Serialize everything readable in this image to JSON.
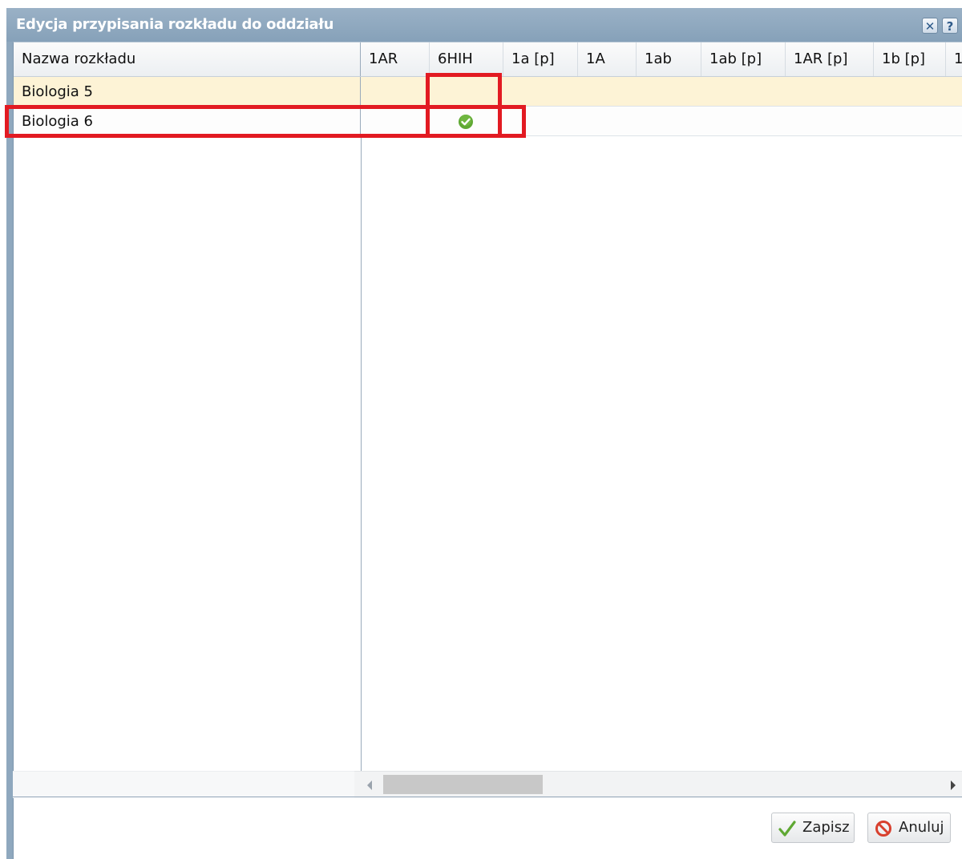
{
  "dialog": {
    "title": "Edycja przypisania rozkładu do oddziału",
    "close_glyph": "✕",
    "help_glyph": "?"
  },
  "grid": {
    "columns": [
      "Nazwa rozkładu",
      "1AR",
      "6HIH",
      "1a [p]",
      "1A",
      "1ab",
      "1ab [p]",
      "1AR [p]",
      "1b [p]",
      "1"
    ],
    "rows": [
      {
        "name": "Biologia 5",
        "assigned": []
      },
      {
        "name": "Biologia 6",
        "assigned": [
          "6HIH"
        ]
      }
    ]
  },
  "icons": {
    "assigned_cell": "check-circle-icon",
    "save": "checkmark-icon",
    "cancel": "prohibited-icon",
    "scroll_left": "arrow-left-icon",
    "scroll_right": "arrow-right-icon"
  },
  "colors": {
    "titlebar": "#8fa8be",
    "selected_row": "#fdf3d6",
    "highlight": "#e21a22",
    "check": "#5fa833",
    "cancel_icon": "#d8402e"
  },
  "footer": {
    "save_label": "Zapisz",
    "cancel_label": "Anuluj"
  }
}
